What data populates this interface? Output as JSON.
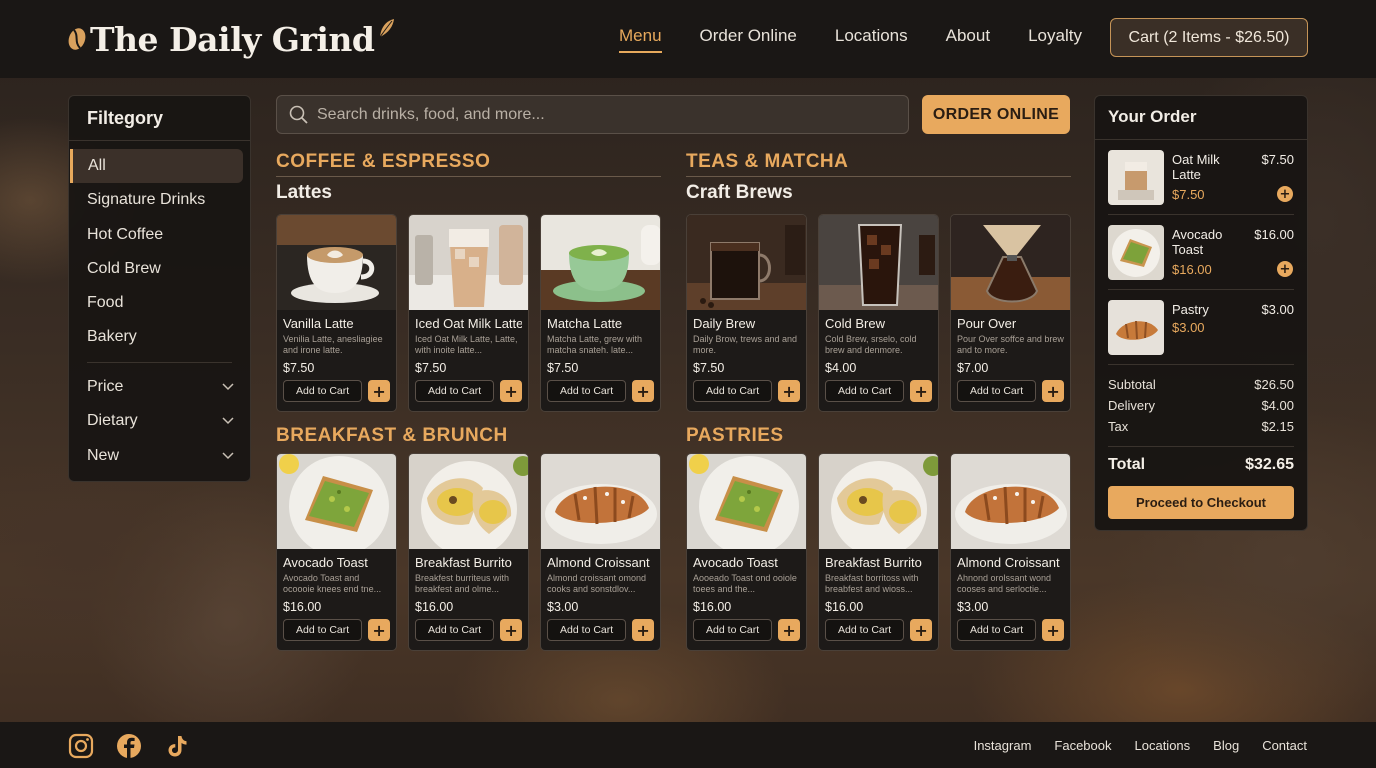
{
  "brand": {
    "name": "The Daily Grind",
    "accent": "#e8a95e"
  },
  "nav": [
    {
      "label": "Menu",
      "active": true
    },
    {
      "label": "Order Online"
    },
    {
      "label": "Locations"
    },
    {
      "label": "About"
    },
    {
      "label": "Loyalty"
    }
  ],
  "cart": {
    "label": "Cart (2 Items - $26.50)"
  },
  "sidebar": {
    "title": "Filtegory",
    "categories": [
      "All",
      "Signature Drinks",
      "Hot Coffee",
      "Cold Brew",
      "Food",
      "Bakery"
    ],
    "filters": [
      "Price",
      "Dietary",
      "New"
    ]
  },
  "search": {
    "placeholder": "Search drinks, food, and more..."
  },
  "order_online_label": "ORDER ONLINE",
  "sections": [
    {
      "title": "COFFEE & ESPRESSO",
      "subtitle": "Lattes",
      "items": [
        {
          "name": "Vanilla Latte",
          "desc": "Venilia Latte, anesliagiee and irone latte.",
          "price": "$7.50",
          "add": "Add to Cart",
          "plus": "+"
        },
        {
          "name": "Iced Oat Milk Latte",
          "desc": "Iced Oat Milk Latte, Latte, with inoite latte...",
          "price": "$7.50",
          "add": "Add to Cart",
          "plus": "+"
        },
        {
          "name": "Matcha Latte",
          "desc": "Matcha Latte, grew with matcha snateh. late...",
          "price": "$7.50",
          "add": "Add to Cart",
          "plus": "+"
        }
      ]
    },
    {
      "title": "TEAS & MATCHA",
      "subtitle": "Craft Brews",
      "items": [
        {
          "name": "Daily Brew",
          "desc": "Daily Brow, trews and and more.",
          "price": "$7.50",
          "add": "Add to Cart",
          "plus": "+"
        },
        {
          "name": "Cold Brew",
          "desc": "Cold Brew, srselo, cold brew and denmore.",
          "price": "$4.00",
          "add": "Add to Cart",
          "plus": "+"
        },
        {
          "name": "Pour Over",
          "desc": "Pour Over soffce and brew and to more.",
          "price": "$7.00",
          "add": "Add to Cart",
          "plus": "+"
        }
      ]
    },
    {
      "title": "BREAKFAST & BRUNCH",
      "subtitle": "",
      "items": [
        {
          "name": "Avocado Toast",
          "desc": "Avocado Toast and ocoooie knees end tne...",
          "price": "$16.00",
          "add": "Add to Cart",
          "plus": "+"
        },
        {
          "name": "Breakfast Burrito",
          "desc": "Breakfest burriteus with breakfest and olme...",
          "price": "$16.00",
          "add": "Add to Cart",
          "plus": "+"
        },
        {
          "name": "Almond Croissant",
          "desc": "Almond croissant omond cooks and sonstdlov...",
          "price": "$3.00",
          "add": "Add to Cart",
          "plus": "+"
        }
      ]
    },
    {
      "title": "PASTRIES",
      "subtitle": "",
      "items": [
        {
          "name": "Avocado Toast",
          "desc": "Aooeado Toast ond ooiole toees and the...",
          "price": "$16.00",
          "add": "Add to Cart",
          "plus": "+"
        },
        {
          "name": "Breakfast Burrito",
          "desc": "Breakfast borritoss with breabfest and wioss...",
          "price": "$16.00",
          "add": "Add to Cart",
          "plus": "+"
        },
        {
          "name": "Almond Croissant",
          "desc": "Ahnond orolssant wond cooses and serloctie...",
          "price": "$3.00",
          "add": "Add to Cart",
          "plus": "+"
        }
      ]
    }
  ],
  "order": {
    "title": "Your Order",
    "items": [
      {
        "name": "Oat Milk Latte",
        "price": "$7.50",
        "sub": "$7.50",
        "plus": "+"
      },
      {
        "name": "Avocado Toast",
        "price": "$16.00",
        "sub": "$16.00",
        "plus": "+"
      },
      {
        "name": "Pastry",
        "price": "$3.00",
        "sub": "$3.00"
      }
    ],
    "subtotal_label": "Subtotal",
    "subtotal": "$26.50",
    "delivery_label": "Delivery",
    "delivery": "$4.00",
    "tax_label": "Tax",
    "tax": "$2.15",
    "total_label": "Total",
    "total": "$32.65",
    "checkout_label": "Proceed to Checkout"
  },
  "footer": {
    "social_icons": [
      "instagram-icon",
      "facebook-icon",
      "tiktok-icon"
    ],
    "links": [
      "Instagram",
      "Facebook",
      "Locations",
      "Blog",
      "Contact"
    ]
  }
}
